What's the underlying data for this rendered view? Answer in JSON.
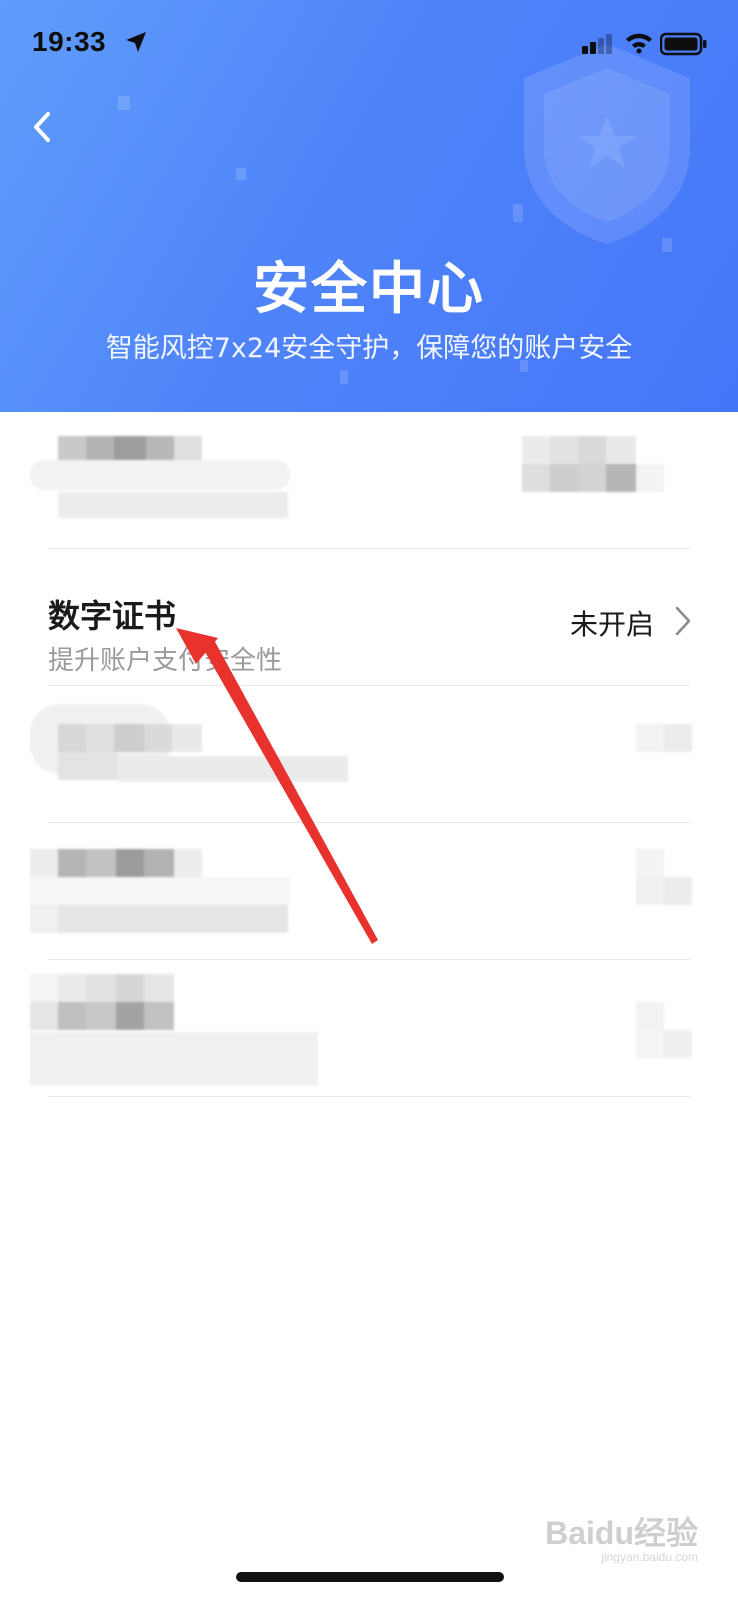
{
  "status_bar": {
    "time": "19:33"
  },
  "header": {
    "title": "安全中心",
    "subtitle": "智能风控7x24安全守护，保障您的账户安全"
  },
  "items": [
    {
      "title": "",
      "desc": "",
      "status": ""
    },
    {
      "title": "数字证书",
      "desc": "提升账户支付安全性",
      "status": "未开启"
    },
    {
      "title": "",
      "desc": "",
      "status": ""
    },
    {
      "title": "",
      "desc": "",
      "status": ""
    },
    {
      "title": "",
      "desc": "",
      "status": ""
    }
  ],
  "watermark": {
    "brand": "Baidu经验",
    "url": "jingyan.baidu.com"
  },
  "colors": {
    "header_gradient_start": "#5f9dfb",
    "header_gradient_end": "#4576f8",
    "annotation_arrow": "#e8322d"
  },
  "icons": [
    "back-icon",
    "location-arrow-icon",
    "signal-icon",
    "wifi-icon",
    "battery-icon",
    "chevron-right-icon",
    "shield-icon"
  ]
}
